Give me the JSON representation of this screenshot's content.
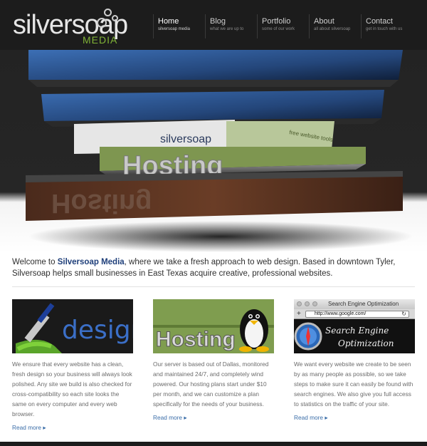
{
  "logo": {
    "main": "silversoap",
    "sub": "MEDIA"
  },
  "nav": [
    {
      "label": "Home",
      "sub": "silversoap media",
      "active": true
    },
    {
      "label": "Blog",
      "sub": "what we are up to"
    },
    {
      "label": "Portfolio",
      "sub": "some of our work"
    },
    {
      "label": "About",
      "sub": "all about silversoap"
    },
    {
      "label": "Contact",
      "sub": "get in touch with us"
    }
  ],
  "hero": {
    "slab_texts": [
      "Hosting",
      "free website tools",
      "silversoap"
    ]
  },
  "intro": {
    "before": "Welcome to ",
    "brand": "Silversoap Media",
    "after": ", where we take a fresh approach to web design. Based in downtown Tyler, Silversoap helps small businesses in East Texas acquire creative, professional websites."
  },
  "columns": [
    {
      "thumb_text": "design",
      "body": "We ensure that every website has a clean, fresh design so your business will always look polished. Any site we build is also checked for cross-compatibility so each site looks the same on every computer and every web browser.",
      "link": "Read more"
    },
    {
      "thumb_text": "Hosting",
      "body": "Our server is based out of Dallas, monitored and maintained 24/7, and completely wind powered. Our hosting plans start under $10 per month, and we can customize a plan specifically for the needs of your business.",
      "link": "Read more"
    },
    {
      "thumb_title": "Search Engine Optimization",
      "thumb_url": "http://www.google.com/",
      "thumb_line1": "Search Engine",
      "thumb_line2": "Optimization",
      "body": "We want every website we create to be seen by as many people as possible, so we take steps to make sure it can easily be found with search engines. We also give you full access to statistics on the traffic of your site.",
      "link": "Read more"
    }
  ],
  "colors": {
    "header_bg": "#1c1c1c",
    "accent_green": "#7fb236",
    "link_blue": "#3a6da8",
    "brand_blue": "#1f3f7a"
  }
}
